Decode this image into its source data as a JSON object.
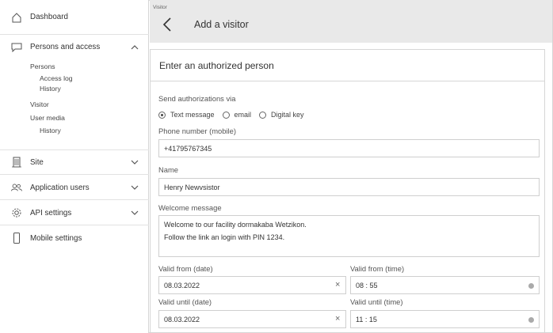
{
  "sidebar": {
    "dashboard": "Dashboard",
    "persons_access": "Persons and access",
    "persons": "Persons",
    "access_log": "Access log",
    "history": "History",
    "visitor": "Visitor",
    "user_media": "User media",
    "history2": "History",
    "site": "Site",
    "application_users": "Application users",
    "api_settings": "API settings",
    "mobile_settings": "Mobile settings"
  },
  "header": {
    "breadcrumb": "Visitor",
    "title": "Add a visitor"
  },
  "form": {
    "card_title": "Enter an authorized person",
    "send_via_label": "Send authorizations via",
    "options": {
      "text_message": "Text message",
      "email": "email",
      "digital_key": "Digital key"
    },
    "selected_option": "Text message",
    "phone_label": "Phone number (mobile)",
    "phone_value": "+41795767345",
    "name_label": "Name",
    "name_value": "Henry Newvsistor",
    "welcome_label": "Welcome message",
    "welcome_line1": "Welcome to our facility dormakaba Wetzikon.",
    "welcome_line2": "Follow the link an login with PIN 1234.",
    "valid_from_date_label": "Valid from (date)",
    "valid_from_date": "08.03.2022",
    "valid_from_time_label": "Valid from (time)",
    "valid_from_time": "08 : 55",
    "valid_until_date_label": "Valid until (date)",
    "valid_until_date": "08.03.2022",
    "valid_until_time_label": "Valid until (time)",
    "valid_until_time": "11 : 15",
    "clear_symbol": "×"
  }
}
